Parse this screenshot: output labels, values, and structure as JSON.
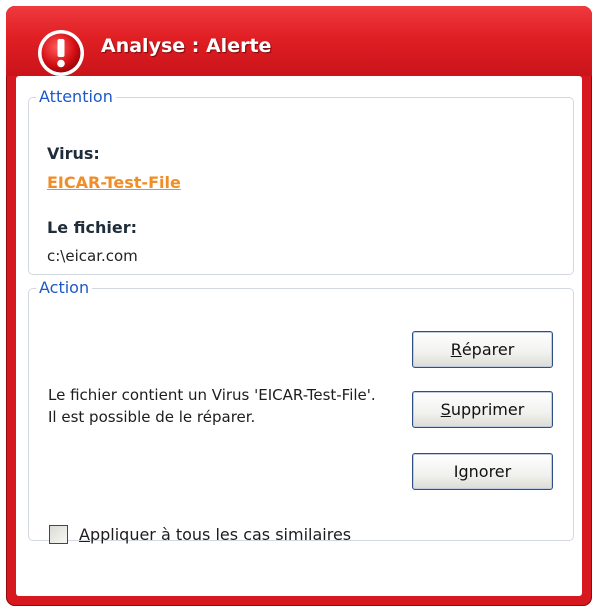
{
  "window": {
    "title": "Analyse : Alerte",
    "icon": "alert-exclamation-icon",
    "accent_color": "#d7181e"
  },
  "attention": {
    "legend": "Attention",
    "virus_label": "Virus:",
    "virus_name": "EICAR-Test-File",
    "virus_name_color": "#f08d27",
    "file_label": "Le fichier:",
    "file_path": "c:\\eicar.com"
  },
  "action": {
    "legend": "Action",
    "message": "Le fichier contient un Virus 'EICAR-Test-File'. Il est possible de le réparer.",
    "buttons": {
      "repair": {
        "accesskey": "R",
        "rest": "éparer"
      },
      "delete": {
        "accesskey": "S",
        "rest": "upprimer"
      },
      "ignore": {
        "pre": "I",
        "accesskey": "g",
        "rest": "norer"
      }
    },
    "apply_all": {
      "accesskey": "A",
      "rest": "ppliquer à tous les cas similaires",
      "checked": false
    }
  }
}
